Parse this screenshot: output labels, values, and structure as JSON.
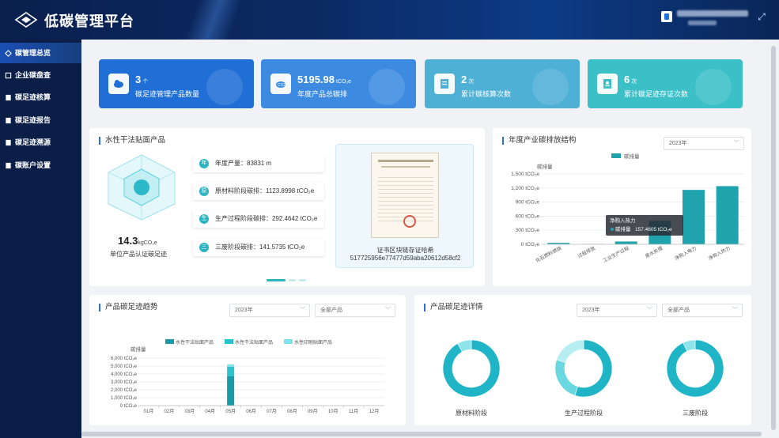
{
  "app": {
    "title": "低碳管理平台"
  },
  "sidebar": {
    "items": [
      {
        "label": "碳管理总览",
        "active": true
      },
      {
        "label": "企业碳盘查"
      },
      {
        "label": "碳足迹核算"
      },
      {
        "label": "碳足迹报告"
      },
      {
        "label": "碳足迹溯源"
      },
      {
        "label": "碳账户设置"
      }
    ]
  },
  "stats": [
    {
      "value": "3",
      "unit": "个",
      "label": "碳足迹管理产品数量",
      "color": "#1f6fd6",
      "icon": "cloud-icon"
    },
    {
      "value": "5195.98",
      "unit": "tCO₂e",
      "label": "年度产品总碳排",
      "color": "#3c8be0",
      "icon": "co2-icon"
    },
    {
      "value": "2",
      "unit": "次",
      "label": "累计碳核算次数",
      "color": "#4fb0d6",
      "icon": "document-icon"
    },
    {
      "value": "6",
      "unit": "次",
      "label": "累计碳足迹存证次数",
      "color": "#3cc0c8",
      "icon": "certificate-icon"
    }
  ],
  "product_panel": {
    "title": "水性干法贴面产品",
    "footprint_value": "14.3",
    "footprint_unit": "kgCO₂e",
    "footprint_label": "单位产品认证碳足迹",
    "rows": [
      {
        "icon_text": "年",
        "text": "年度产量：83831 m"
      },
      {
        "icon_text": "原",
        "text": "原材料阶段碳排：1123.8998 tCO₂e"
      },
      {
        "icon_text": "生",
        "text": "生产过程阶段碳排：292.4642 tCO₂e"
      },
      {
        "icon_text": "三",
        "text": "三废阶段碳排：141.5735 tCO₂e"
      }
    ],
    "cert_label": "证书区块链存证哈希",
    "cert_hash": "517725956e77477d59aba20612d58cf2"
  },
  "annual_structure": {
    "title": "年度产业碳排放结构",
    "year_select": "2023年",
    "tooltip": {
      "title": "净购入热力",
      "label": "碳排量",
      "value": "157.4605 tCO₂e"
    }
  },
  "trend_panel": {
    "title": "产品碳足迹趋势",
    "year_select": "2023年",
    "product_select": "全部产品"
  },
  "detail_panel": {
    "title": "产品碳足迹详情",
    "year_select": "2023年",
    "product_select": "全部产品",
    "donuts": [
      {
        "label": "原材料阶段",
        "fractions": [
          0.92,
          0.08
        ],
        "colors": [
          "#1fb5c7",
          "#8ee3ea"
        ]
      },
      {
        "label": "生产过程阶段",
        "fractions": [
          0.55,
          0.25,
          0.2
        ],
        "colors": [
          "#1fb5c7",
          "#6ad8e0",
          "#b7eef2"
        ]
      },
      {
        "label": "三废阶段",
        "fractions": [
          0.93,
          0.07
        ],
        "colors": [
          "#1fb5c7",
          "#8ee3ea"
        ]
      }
    ]
  },
  "chart_data": [
    {
      "type": "bar",
      "title": "年度产业碳排放结构",
      "ylabel": "碳排量",
      "legend": [
        "碳排量"
      ],
      "legend_placement": "top",
      "categories": [
        "化石燃料燃烧",
        "过程排放",
        "工业生产过程",
        "废水处理",
        "净购入电力",
        "净购入热力"
      ],
      "series": [
        {
          "name": "碳排量",
          "values": [
            30,
            5,
            60,
            500,
            1160,
            1240
          ],
          "color": "#1fa3ad"
        }
      ],
      "ylim": [
        0,
        1500
      ],
      "yticks": [
        0,
        300,
        600,
        900,
        1200,
        1500
      ],
      "ytick_labels": [
        "0 tCO₂e",
        "300 tCO₂e",
        "600 tCO₂e",
        "900 tCO₂e",
        "1,200 tCO₂e",
        "1,500 tCO₂e"
      ]
    },
    {
      "type": "bar",
      "title": "产品碳足迹趋势",
      "ylabel": "碳排量",
      "legend_placement": "top",
      "categories": [
        "01月",
        "02月",
        "03月",
        "04月",
        "05月",
        "06月",
        "07月",
        "08月",
        "09月",
        "10月",
        "11月",
        "12月"
      ],
      "series": [
        {
          "name": "水性干法贴面产品",
          "values": [
            0,
            0,
            0,
            0,
            3700,
            0,
            0,
            0,
            0,
            0,
            0,
            0
          ],
          "color": "#1a9aa6"
        },
        {
          "name": "水性干法贴面产品",
          "values": [
            0,
            0,
            0,
            0,
            1200,
            0,
            0,
            0,
            0,
            0,
            0,
            0
          ],
          "color": "#2cc3cd"
        },
        {
          "name": "水性印刷贴面产品",
          "values": [
            0,
            0,
            0,
            0,
            300,
            0,
            0,
            0,
            0,
            0,
            0,
            0
          ],
          "color": "#7fe3ec"
        }
      ],
      "stacked": true,
      "ylim": [
        0,
        6000
      ],
      "yticks": [
        0,
        1000,
        2000,
        3000,
        4000,
        5000,
        6000
      ],
      "ytick_labels": [
        "0 tCO₂e",
        "1,000 tCO₂e",
        "2,000 tCO₂e",
        "3,000 tCO₂e",
        "4,000 tCO₂e",
        "5,000 tCO₂e",
        "6,000 tCO₂e"
      ]
    }
  ]
}
